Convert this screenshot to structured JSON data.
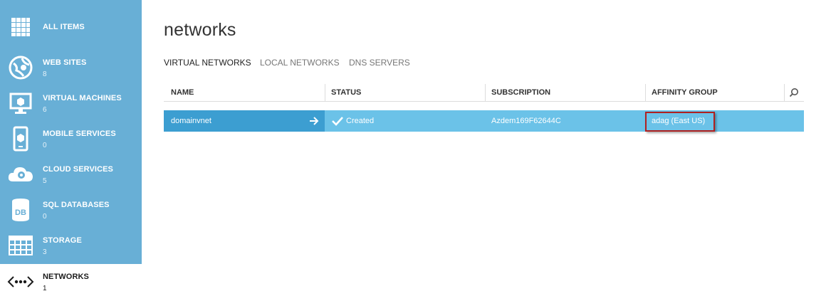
{
  "sidebar": {
    "items": [
      {
        "label": "ALL ITEMS",
        "count": "",
        "icon": "grid-icon"
      },
      {
        "label": "WEB SITES",
        "count": "8",
        "icon": "globe-icon"
      },
      {
        "label": "VIRTUAL MACHINES",
        "count": "6",
        "icon": "monitor-icon"
      },
      {
        "label": "MOBILE SERVICES",
        "count": "0",
        "icon": "phone-icon"
      },
      {
        "label": "CLOUD SERVICES",
        "count": "5",
        "icon": "cloud-gear-icon"
      },
      {
        "label": "SQL DATABASES",
        "count": "0",
        "icon": "database-icon"
      },
      {
        "label": "STORAGE",
        "count": "3",
        "icon": "table-icon"
      },
      {
        "label": "NETWORKS",
        "count": "1",
        "icon": "network-icon"
      }
    ],
    "colors": {
      "background": "#68afd6",
      "active_background": "#ffffff"
    }
  },
  "main": {
    "title": "networks",
    "tabs": [
      {
        "label": "VIRTUAL NETWORKS",
        "active": true
      },
      {
        "label": "LOCAL NETWORKS",
        "active": false
      },
      {
        "label": "DNS SERVERS",
        "active": false
      }
    ],
    "table": {
      "columns": [
        "NAME",
        "STATUS",
        "SUBSCRIPTION",
        "AFFINITY GROUP"
      ],
      "rows": [
        {
          "name": "domainvnet",
          "status": "Created",
          "subscription": "Azdem169F62644C",
          "affinity_group": "adag (East US)"
        }
      ]
    },
    "colors": {
      "row_selected": "#6bc2e8",
      "name_cell": "#3c9ed1",
      "highlight_border": "#b02020"
    }
  }
}
